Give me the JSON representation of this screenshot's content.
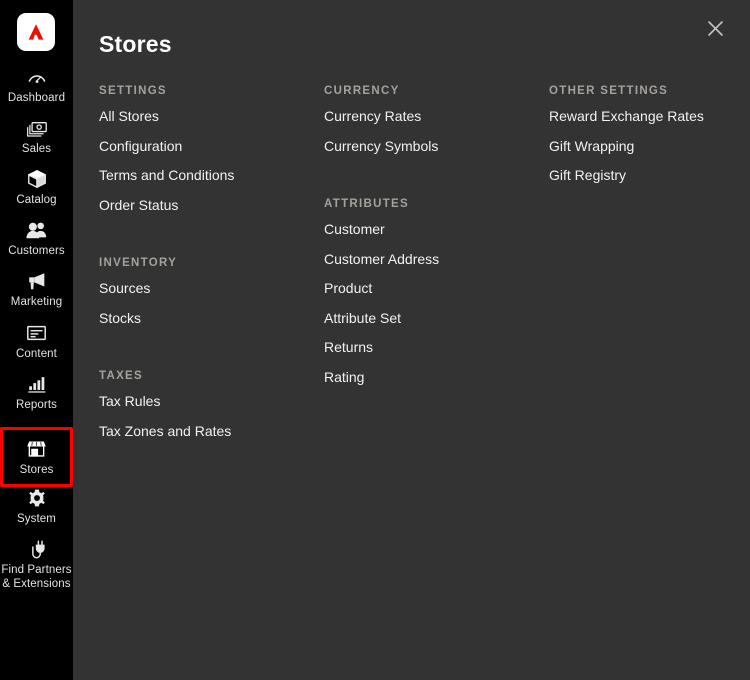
{
  "window": {
    "background_color": "#333333",
    "sidebar_color": "#000000",
    "accent_highlight_color": "#ff0000",
    "brand_mark_color": "#eb1000"
  },
  "sidebar": {
    "logo_name": "adobe-commerce-logo",
    "items": [
      {
        "icon": "dashboard-gauge-icon",
        "label": "Dashboard",
        "active": false
      },
      {
        "icon": "sales-money-icon",
        "label": "Sales",
        "active": false
      },
      {
        "icon": "catalog-box-icon",
        "label": "Catalog",
        "active": false
      },
      {
        "icon": "customers-people-icon",
        "label": "Customers",
        "active": false
      },
      {
        "icon": "marketing-megaphone-icon",
        "label": "Marketing",
        "active": false
      },
      {
        "icon": "content-page-icon",
        "label": "Content",
        "active": false
      },
      {
        "icon": "reports-bar-chart-icon",
        "label": "Reports",
        "active": false
      },
      {
        "icon": "stores-storefront-icon",
        "label": "Stores",
        "active": true
      },
      {
        "icon": "system-gear-icon",
        "label": "System",
        "active": false
      },
      {
        "icon": "find-partners-plug-icon",
        "label": "Find Partners\n& Extensions",
        "active": false
      }
    ]
  },
  "panel": {
    "title": "Stores",
    "close_icon": "close-x-icon",
    "columns": [
      {
        "groups": [
          {
            "title": "SETTINGS",
            "links": [
              "All Stores",
              "Configuration",
              "Terms and Conditions",
              "Order Status"
            ]
          },
          {
            "title": "INVENTORY",
            "links": [
              "Sources",
              "Stocks"
            ]
          },
          {
            "title": "TAXES",
            "links": [
              "Tax Rules",
              "Tax Zones and Rates"
            ]
          }
        ]
      },
      {
        "groups": [
          {
            "title": "CURRENCY",
            "links": [
              "Currency Rates",
              "Currency Symbols"
            ]
          },
          {
            "title": "ATTRIBUTES",
            "links": [
              "Customer",
              "Customer Address",
              "Product",
              "Attribute Set",
              "Returns",
              "Rating"
            ]
          }
        ]
      },
      {
        "groups": [
          {
            "title": "OTHER SETTINGS",
            "links": [
              "Reward Exchange Rates",
              "Gift Wrapping",
              "Gift Registry"
            ]
          }
        ]
      }
    ]
  }
}
